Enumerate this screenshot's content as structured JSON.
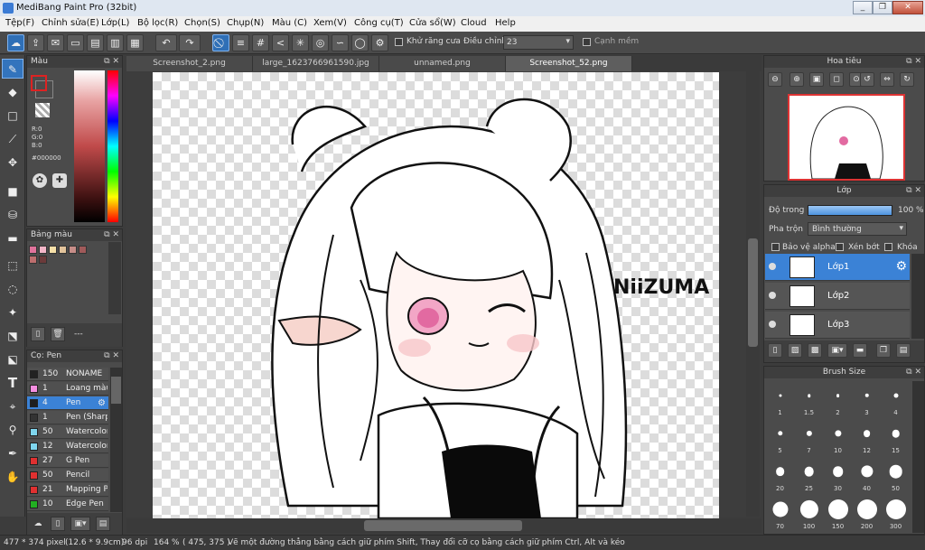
{
  "app": {
    "title": "MediBang Paint Pro (32bit)"
  },
  "window_controls": {
    "minimize": "_",
    "restore": "❐",
    "close": "✕"
  },
  "menu": [
    "Tệp(F)",
    "Chỉnh sửa(E)",
    "Lớp(L)",
    "Bộ lọc(R)",
    "Chọn(S)",
    "Chụp(N)",
    "Màu (C)",
    "Xem(V)",
    "Công cụ(T)",
    "Cửa sổ(W)",
    "Cloud",
    "Help"
  ],
  "toolbar": {
    "antialias_label": "Khử răng cưa",
    "adjust_label": "Điều chỉnh",
    "adjust_value": "23",
    "soft_edge_label": "Cạnh mềm"
  },
  "color_panel": {
    "title": "Màu",
    "r": "R:0",
    "g": "G:0",
    "b": "B:0",
    "hex": "#000000",
    "foreground": "#000000",
    "background": "#ffffff"
  },
  "palette_panel": {
    "title": "Bảng màu",
    "colors": [
      "#e0739c",
      "#f3b6c8",
      "#f6e0a8",
      "#e2c39b",
      "#c68d88",
      "#a05a5a",
      "#bd6e6e",
      "#6b3a3a"
    ],
    "more_label": "---"
  },
  "brush_panel": {
    "title": "Cọ: Pen",
    "items": [
      {
        "color": "#222222",
        "size": "150",
        "name": "NONAME"
      },
      {
        "color": "#f58ee0",
        "size": "1",
        "name": "Loang màu"
      },
      {
        "color": "#1e1e1e",
        "size": "4",
        "name": "Pen"
      },
      {
        "color": "#333333",
        "size": "1",
        "name": "Pen (Sharp)"
      },
      {
        "color": "#7fd6ee",
        "size": "50",
        "name": "Watercolor"
      },
      {
        "color": "#7fd6ee",
        "size": "12",
        "name": "Watercolor"
      },
      {
        "color": "#e03030",
        "size": "27",
        "name": "G Pen"
      },
      {
        "color": "#e03030",
        "size": "50",
        "name": "Pencil"
      },
      {
        "color": "#e03030",
        "size": "21",
        "name": "Mapping Pen"
      },
      {
        "color": "#22b022",
        "size": "10",
        "name": "Edge Pen"
      }
    ]
  },
  "tabs": [
    "Screenshot_2.png",
    "large_1623766961590.jpg",
    "unnamed.png",
    "Screenshot_52.png"
  ],
  "canvas_text": "NiiZUMA",
  "navigator": {
    "title": "Hoa tiêu"
  },
  "layers_panel": {
    "title": "Lớp",
    "opacity_label": "Độ trong",
    "opacity_value": "100 %",
    "opacity_level": 1.0,
    "blend_label": "Pha trộn",
    "blend_value": "Bình thường",
    "protect_alpha": "Bảo vệ alpha",
    "clipping": "Xén bớt",
    "lock": "Khóa",
    "layers": [
      {
        "name": "Lớp1",
        "selected": true
      },
      {
        "name": "Lớp2",
        "selected": false
      },
      {
        "name": "Lớp3",
        "selected": false
      }
    ]
  },
  "brush_size_panel": {
    "title": "Brush Size",
    "sizes": [
      "1",
      "1.5",
      "2",
      "3",
      "4",
      "5",
      "7",
      "10",
      "12",
      "15",
      "20",
      "25",
      "30",
      "40",
      "50",
      "70",
      "100",
      "150",
      "200",
      "300"
    ]
  },
  "status": {
    "size": "477 * 374 pixel",
    "physical": "(12.6 * 9.9cm)",
    "dpi": "96 dpi",
    "zoom": "164 %",
    "coords": "( 475, 375 )",
    "hint": "Vẽ một đường thẳng bằng cách giữ phím Shift, Thay đổi cỡ cọ bằng cách giữ phím Ctrl, Alt và kéo"
  }
}
